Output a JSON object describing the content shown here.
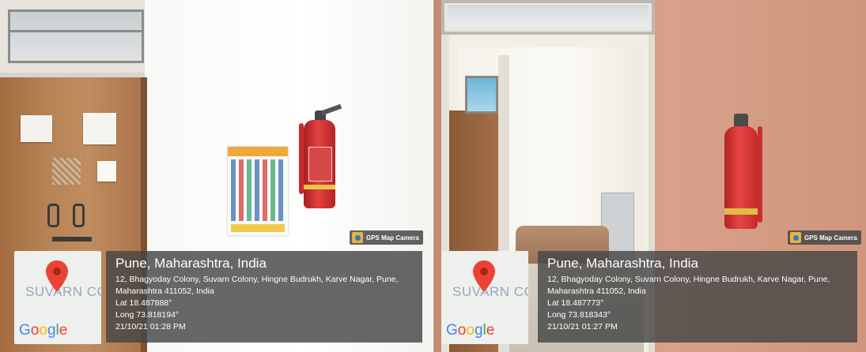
{
  "panels": [
    {
      "badge": "GPS Map Camera",
      "title": "Pune, Maharashtra, India",
      "address": "12, Bhagyoday Colony, Suvarn Colony, Hingne Budrukh, Karve Nagar, Pune, Maharashtra 411052, India",
      "lat": "Lat 18.487888°",
      "long": "Long 73.818194°",
      "datetime": "21/10/21 01:28 PM",
      "map_label": "SUVARN COL",
      "map_logo": "Google"
    },
    {
      "badge": "GPS Map Camera",
      "title": "Pune, Maharashtra, India",
      "address": "12, Bhagyoday Colony, Suvarn Colony, Hingne Budrukh, Karve Nagar, Pune, Maharashtra 411052, India",
      "lat": "Lat 18.487773°",
      "long": "Long 73.818343°",
      "datetime": "21/10/21 01:27 PM",
      "map_label": "SUVARN COL",
      "map_logo": "Google"
    }
  ],
  "colors": {
    "wall_left": "#f7f7f4",
    "door_wood": "#b07a4d",
    "wall_right": "#d49c85",
    "extinguisher": "#d93434",
    "pin": "#ea4335"
  }
}
